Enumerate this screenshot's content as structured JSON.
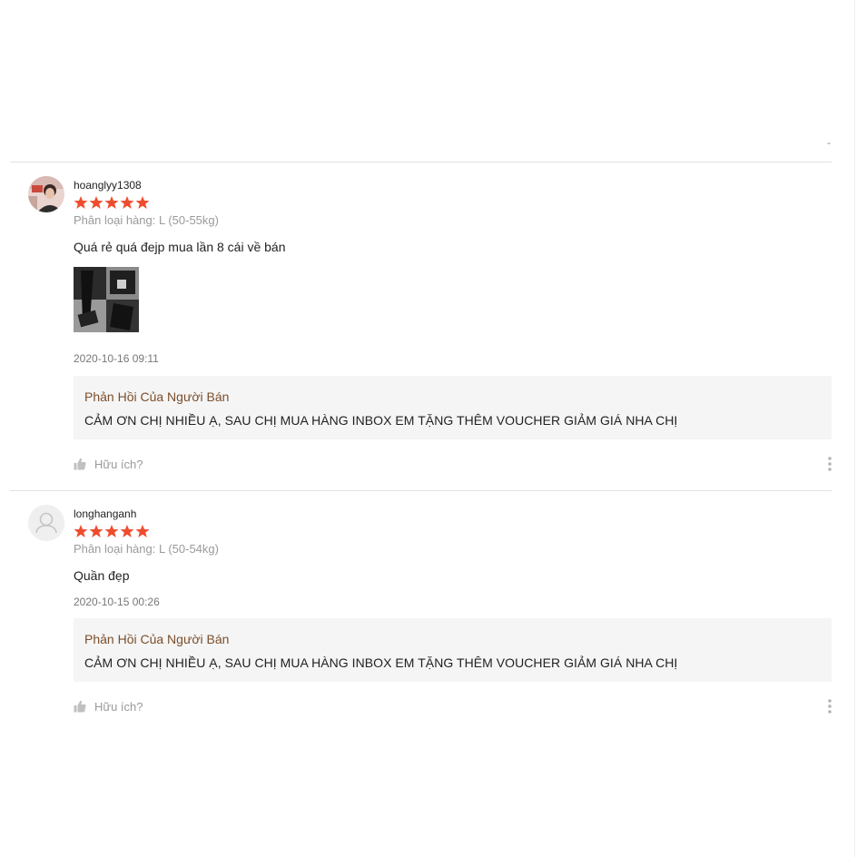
{
  "reviews": [
    {
      "username": "hoanglyy1308",
      "rating": 5,
      "variation": "Phân loại hàng: L (50-55kg)",
      "comment": "Quá rẻ quá đejp mua lần 8 cái về bán",
      "has_photo": true,
      "time": "2020-10-16 09:11",
      "reply_title": "Phản Hồi Của Người Bán",
      "reply_text": "CẢM ƠN CHỊ NHIỀU Ạ, SAU CHỊ MUA HÀNG INBOX EM TẶNG THÊM VOUCHER GIẢM GIÁ NHA CHỊ",
      "helpful_label": "Hữu ích?"
    },
    {
      "username": "longhanganh",
      "rating": 5,
      "variation": "Phân loại hàng: L (50-54kg)",
      "comment": "Quần đẹp",
      "has_photo": false,
      "time": "2020-10-15 00:26",
      "reply_title": "Phản Hồi Của Người Bán",
      "reply_text": "CẢM ƠN CHỊ NHIỀU Ạ, SAU CHỊ MUA HÀNG INBOX EM TẶNG THÊM VOUCHER GIẢM GIÁ NHA CHỊ",
      "helpful_label": "Hữu ích?"
    }
  ],
  "colors": {
    "star": "#ee4d2d",
    "reply_title": "#7b4e2b",
    "reply_bg": "#f5f5f5"
  },
  "icons": [
    "star-icon",
    "thumbs-up-icon",
    "more-vertical-icon",
    "default-avatar-icon"
  ]
}
